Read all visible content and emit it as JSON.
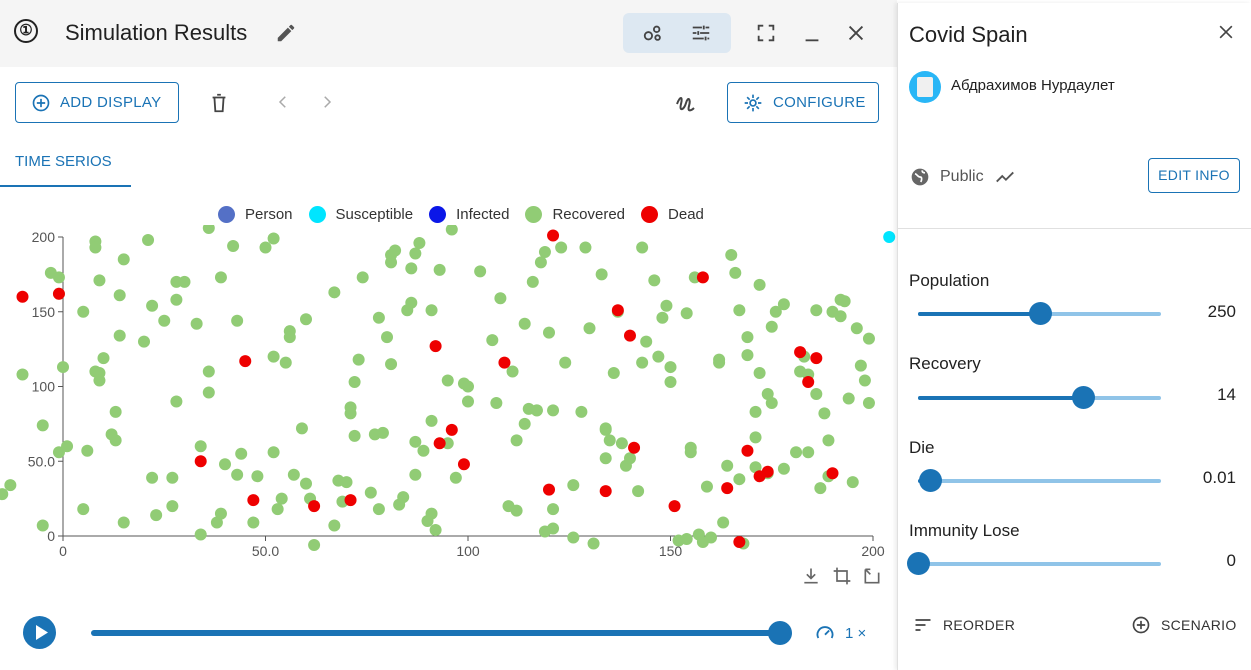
{
  "header": {
    "step": "①",
    "title": "Simulation Results"
  },
  "toolbar": {
    "add_display": "ADD DISPLAY",
    "configure": "CONFIGURE"
  },
  "tabs": [
    {
      "label": "TIME SERIOS",
      "active": true
    }
  ],
  "legend": [
    {
      "name": "Person",
      "color": "#5470c6"
    },
    {
      "name": "Susceptible",
      "color": "#00e5ff"
    },
    {
      "name": "Infected",
      "color": "#0b17e8"
    },
    {
      "name": "Recovered",
      "color": "#91cc75"
    },
    {
      "name": "Dead",
      "color": "#ee0000"
    }
  ],
  "chart_data": {
    "type": "scatter",
    "xlim": [
      0,
      200
    ],
    "ylim": [
      0,
      200
    ],
    "x_ticks": [
      "0",
      "50.0",
      "100",
      "150",
      "200"
    ],
    "y_ticks": [
      "0",
      "50.0",
      "100",
      "150",
      "200"
    ],
    "grid": false,
    "legend_position": "top",
    "series": [
      {
        "name": "Susceptible",
        "color": "#00e5ff",
        "points": [
          [
            204,
            200
          ]
        ]
      },
      {
        "name": "Recovered",
        "color": "#91cc75",
        "points": [
          [
            -15,
            28
          ],
          [
            -13,
            34
          ],
          [
            -10,
            108
          ],
          [
            -5,
            74
          ],
          [
            -5,
            7
          ],
          [
            -3,
            176
          ],
          [
            -1,
            162
          ],
          [
            -1,
            173
          ],
          [
            0,
            113
          ],
          [
            -1,
            56
          ],
          [
            1,
            60
          ],
          [
            5,
            18
          ],
          [
            5,
            150
          ],
          [
            6,
            57
          ],
          [
            8,
            110
          ],
          [
            8,
            197
          ],
          [
            8,
            193
          ],
          [
            9,
            171
          ],
          [
            9,
            109
          ],
          [
            9,
            104
          ],
          [
            10,
            119
          ],
          [
            12,
            68
          ],
          [
            13,
            64
          ],
          [
            13,
            83
          ],
          [
            14,
            134
          ],
          [
            14,
            161
          ],
          [
            15,
            185
          ],
          [
            15,
            9
          ],
          [
            20,
            130
          ],
          [
            21,
            198
          ],
          [
            22,
            154
          ],
          [
            22,
            39
          ],
          [
            23,
            14
          ],
          [
            25,
            144
          ],
          [
            27,
            39
          ],
          [
            27,
            20
          ],
          [
            28,
            90
          ],
          [
            28,
            158
          ],
          [
            28,
            170
          ],
          [
            30,
            170
          ],
          [
            33,
            142
          ],
          [
            34,
            1
          ],
          [
            34,
            60
          ],
          [
            36,
            110
          ],
          [
            36,
            96
          ],
          [
            36,
            206
          ],
          [
            38,
            9
          ],
          [
            39,
            173
          ],
          [
            39,
            15
          ],
          [
            40,
            48
          ],
          [
            42,
            194
          ],
          [
            43,
            144
          ],
          [
            43,
            41
          ],
          [
            44,
            55
          ],
          [
            47,
            9
          ],
          [
            48,
            40
          ],
          [
            50,
            193
          ],
          [
            52,
            120
          ],
          [
            52,
            199
          ],
          [
            52,
            56
          ],
          [
            53,
            18
          ],
          [
            54,
            25
          ],
          [
            55,
            116
          ],
          [
            56,
            137
          ],
          [
            56,
            133
          ],
          [
            57,
            41
          ],
          [
            59,
            72
          ],
          [
            60,
            145
          ],
          [
            60,
            35
          ],
          [
            61,
            25
          ],
          [
            62,
            -6
          ],
          [
            67,
            7
          ],
          [
            67,
            163
          ],
          [
            68,
            37
          ],
          [
            69,
            23
          ],
          [
            70,
            36
          ],
          [
            71,
            82
          ],
          [
            71,
            86
          ],
          [
            72,
            103
          ],
          [
            72,
            67
          ],
          [
            73,
            118
          ],
          [
            74,
            173
          ],
          [
            76,
            29
          ],
          [
            77,
            68
          ],
          [
            78,
            18
          ],
          [
            78,
            146
          ],
          [
            79,
            69
          ],
          [
            80,
            133
          ],
          [
            81,
            115
          ],
          [
            81,
            183
          ],
          [
            81,
            188
          ],
          [
            82,
            191
          ],
          [
            83,
            21
          ],
          [
            84,
            26
          ],
          [
            85,
            151
          ],
          [
            86,
            179
          ],
          [
            86,
            156
          ],
          [
            87,
            63
          ],
          [
            87,
            189
          ],
          [
            87,
            41
          ],
          [
            88,
            196
          ],
          [
            89,
            57
          ],
          [
            90,
            10
          ],
          [
            91,
            77
          ],
          [
            91,
            15
          ],
          [
            91,
            151
          ],
          [
            92,
            4
          ],
          [
            93,
            178
          ],
          [
            95,
            104
          ],
          [
            95,
            62
          ],
          [
            96,
            205
          ],
          [
            97,
            39
          ],
          [
            99,
            102
          ],
          [
            100,
            90
          ],
          [
            100,
            100
          ],
          [
            103,
            177
          ],
          [
            106,
            131
          ],
          [
            107,
            89
          ],
          [
            108,
            159
          ],
          [
            110,
            20
          ],
          [
            111,
            110
          ],
          [
            112,
            17
          ],
          [
            112,
            64
          ],
          [
            114,
            75
          ],
          [
            114,
            142
          ],
          [
            115,
            85
          ],
          [
            116,
            170
          ],
          [
            117,
            84
          ],
          [
            117,
            84
          ],
          [
            118,
            183
          ],
          [
            119,
            190
          ],
          [
            119,
            3
          ],
          [
            120,
            136
          ],
          [
            121,
            18
          ],
          [
            121,
            84
          ],
          [
            121,
            5
          ],
          [
            123,
            193
          ],
          [
            124,
            116
          ],
          [
            126,
            -1
          ],
          [
            126,
            34
          ],
          [
            128,
            83
          ],
          [
            129,
            193
          ],
          [
            130,
            139
          ],
          [
            131,
            -5
          ],
          [
            133,
            175
          ],
          [
            134,
            71
          ],
          [
            134,
            52
          ],
          [
            134,
            72
          ],
          [
            135,
            64
          ],
          [
            136,
            109
          ],
          [
            137,
            150
          ],
          [
            138,
            62
          ],
          [
            139,
            47
          ],
          [
            140,
            52
          ],
          [
            142,
            30
          ],
          [
            143,
            193
          ],
          [
            143,
            116
          ],
          [
            144,
            130
          ],
          [
            146,
            171
          ],
          [
            147,
            120
          ],
          [
            148,
            146
          ],
          [
            149,
            154
          ],
          [
            150,
            113
          ],
          [
            150,
            103
          ],
          [
            152,
            -3
          ],
          [
            154,
            149
          ],
          [
            154,
            -2
          ],
          [
            155,
            56
          ],
          [
            155,
            59
          ],
          [
            156,
            173
          ],
          [
            157,
            1
          ],
          [
            158,
            -4
          ],
          [
            159,
            33
          ],
          [
            160,
            -1
          ],
          [
            162,
            116
          ],
          [
            162,
            118
          ],
          [
            163,
            9
          ],
          [
            164,
            47
          ],
          [
            165,
            188
          ],
          [
            166,
            176
          ],
          [
            167,
            38
          ],
          [
            167,
            151
          ],
          [
            168,
            -5
          ],
          [
            169,
            133
          ],
          [
            169,
            121
          ],
          [
            171,
            83
          ],
          [
            171,
            46
          ],
          [
            171,
            66
          ],
          [
            172,
            109
          ],
          [
            172,
            168
          ],
          [
            174,
            42
          ],
          [
            174,
            95
          ],
          [
            175,
            140
          ],
          [
            175,
            89
          ],
          [
            176,
            150
          ],
          [
            178,
            45
          ],
          [
            178,
            155
          ],
          [
            181,
            56
          ],
          [
            182,
            110
          ],
          [
            183,
            120
          ],
          [
            184,
            56
          ],
          [
            184,
            108
          ],
          [
            186,
            95
          ],
          [
            186,
            151
          ],
          [
            187,
            32
          ],
          [
            188,
            82
          ],
          [
            189,
            40
          ],
          [
            189,
            64
          ],
          [
            190,
            150
          ],
          [
            192,
            147
          ],
          [
            192,
            158
          ],
          [
            193,
            157
          ],
          [
            194,
            92
          ],
          [
            195,
            36
          ],
          [
            196,
            139
          ],
          [
            197,
            114
          ],
          [
            198,
            104
          ],
          [
            199,
            132
          ],
          [
            199,
            89
          ]
        ]
      },
      {
        "name": "Dead",
        "color": "#ee0000",
        "points": [
          [
            -10,
            160
          ],
          [
            -1,
            162
          ],
          [
            45,
            117
          ],
          [
            34,
            50
          ],
          [
            47,
            24
          ],
          [
            62,
            20
          ],
          [
            71,
            24
          ],
          [
            92,
            127
          ],
          [
            93,
            62
          ],
          [
            96,
            71
          ],
          [
            99,
            48
          ],
          [
            109,
            116
          ],
          [
            120,
            31
          ],
          [
            121,
            201
          ],
          [
            134,
            30
          ],
          [
            137,
            151
          ],
          [
            140,
            134
          ],
          [
            141,
            59
          ],
          [
            151,
            20
          ],
          [
            158,
            173
          ],
          [
            164,
            32
          ],
          [
            167,
            -4
          ],
          [
            169,
            57
          ],
          [
            172,
            40
          ],
          [
            174,
            43
          ],
          [
            182,
            123
          ],
          [
            184,
            103
          ],
          [
            186,
            119
          ],
          [
            190,
            42
          ]
        ]
      }
    ]
  },
  "playback": {
    "speed": "1 ×",
    "progress": 1.0
  },
  "panel": {
    "title": "Covid Spain",
    "user": "Абдрахимов Нурдаулет",
    "visibility": "Public",
    "edit_info": "EDIT INFO",
    "params": [
      {
        "label": "Population",
        "value": "250",
        "fraction": 0.5
      },
      {
        "label": "Recovery",
        "value": "14",
        "fraction": 0.68
      },
      {
        "label": "Die",
        "value": "0.01",
        "fraction": 0.05
      },
      {
        "label": "Immunity Lose",
        "value": "0",
        "fraction": 0.0
      }
    ],
    "reorder": "REORDER",
    "scenario": "SCENARIO"
  }
}
